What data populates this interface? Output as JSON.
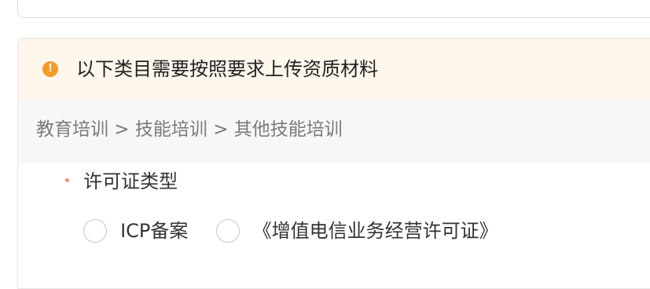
{
  "alert": {
    "icon": "info-icon",
    "icon_glyph": "!",
    "message": "以下类目需要按照要求上传资质材料",
    "background": "#fff6ec",
    "icon_color": "#f39b29"
  },
  "breadcrumb": {
    "path": "教育培训 > 技能培训 > 其他技能培训"
  },
  "license_field": {
    "label": "许可证类型",
    "required_color": "#f08a80",
    "options": [
      {
        "label": "ICP备案",
        "selected": false
      },
      {
        "label": "《增值电信业务经营许可证》",
        "selected": false
      }
    ]
  }
}
